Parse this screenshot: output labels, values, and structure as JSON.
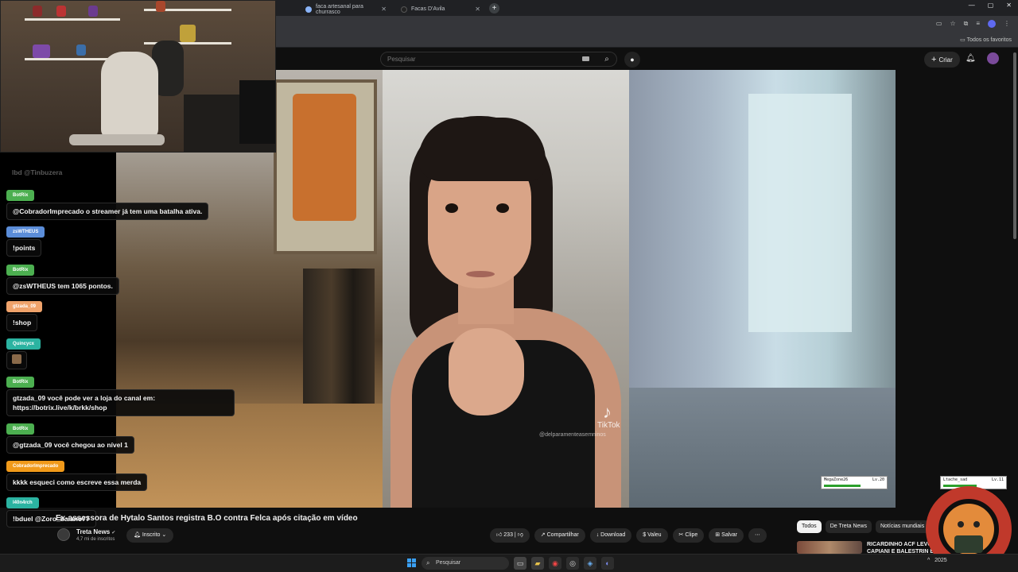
{
  "browser": {
    "tabs": [
      {
        "label": "faca artesanal para churrasco"
      },
      {
        "label": "Facas D'Avila"
      }
    ],
    "new_tab": "+",
    "window_controls": [
      "—",
      "▢",
      "✕"
    ],
    "bookmarks_label": "Todos os favoritos"
  },
  "youtube": {
    "search_placeholder": "Pesquisar",
    "create_label": "Criar"
  },
  "video": {
    "title": "Ex-assessora de Hytalo Santos registra B.O contra Felca após citação em vídeo",
    "watermark": "TikTok",
    "watermark_handle": "@delparamenteasemninos",
    "channel": {
      "name": "Treta News",
      "subscribers": "4,7 mi de inscritos",
      "subscribed_label": "Inscrito"
    },
    "actions": {
      "like_count": "233",
      "share": "Compartilhar",
      "download": "Download",
      "thanks": "Valeu",
      "clip": "Clipe",
      "save": "Salvar",
      "more": "⋯"
    }
  },
  "chips": {
    "all": "Todos",
    "from_channel": "De Treta News",
    "world_news": "Notícias mundiais"
  },
  "recommendation": {
    "title": "RICARDINHO ACF LEVOU CAPIANI E BALESTRIN EM"
  },
  "chat": {
    "top_message": "lbd @Tinbuzera",
    "messages": [
      {
        "user": "BotRix",
        "text": "@CobradorImprecado o streamer já tem uma batalha ativa."
      },
      {
        "user": "zsWTHEUS",
        "text": "!points"
      },
      {
        "user": "BotRix",
        "text": "@zsWTHEUS tem 1065 pontos."
      },
      {
        "user": "gtzada_09",
        "text": "!shop"
      },
      {
        "user": "Quincycx",
        "text": ""
      },
      {
        "user": "BotRix",
        "text": "gtzada_09 você pode ver a loja do canal em:",
        "text2": "https://botrix.live/k/brkk/shop"
      },
      {
        "user": "BotRix",
        "text": "@gtzada_09 você chegou ao nível 1"
      },
      {
        "user": "CobradorImprecado",
        "text": "kkkk esqueci como escreve essa merda"
      },
      {
        "user": "l40n4rch",
        "text": "!bduel @Zoro_baiano77"
      }
    ],
    "badge_colors": [
      "#4caf50",
      "#5b8dd9",
      "#4caf50",
      "#f0a36b",
      "#2bb3a1",
      "#4caf50",
      "#4caf50",
      "#f19a1a",
      "#2bb3a1"
    ]
  },
  "hud": [
    {
      "name": "MegaZone26",
      "level": "Lv.20",
      "fill": 0.6
    },
    {
      "name": "Ltache_sad",
      "level": "Lv.11",
      "fill": 0.55
    }
  ],
  "taskbar": {
    "search_placeholder": "Pesquisar",
    "year": "2025"
  }
}
